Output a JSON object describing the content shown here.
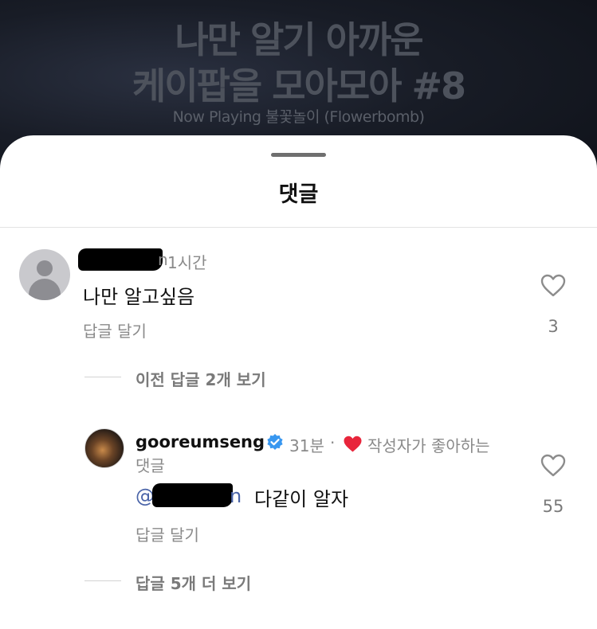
{
  "video": {
    "title_line1": "나만 알기 아까운",
    "title_line2": "케이팝을 모아모아 #8",
    "now_playing": "Now Playing 불꽃놀이 (Flowerbomb)"
  },
  "sheet": {
    "title": "댓글"
  },
  "comment1": {
    "username_suffix": "n",
    "time": "1시간",
    "text": "나만 알고싶음",
    "reply_label": "답글 달기",
    "likes": "3",
    "username_redacted": true
  },
  "thread_prev": {
    "label": "이전 답글 2개 보기"
  },
  "reply1": {
    "username": "gooreumseng",
    "time": "31분",
    "dot": "·",
    "liked_by_author_line1": "작성자가 좋아하는",
    "liked_by_author_line2": "댓글",
    "mention_at": "@",
    "mention_suffix": "n",
    "text": "다같이 알자",
    "reply_label": "답글 달기",
    "likes": "55"
  },
  "thread_more": {
    "label": "답글 5개 더 보기"
  },
  "colors": {
    "heart_red": "#e8253b",
    "verified_blue": "#3897f0",
    "mention_blue": "#4a64a8"
  }
}
